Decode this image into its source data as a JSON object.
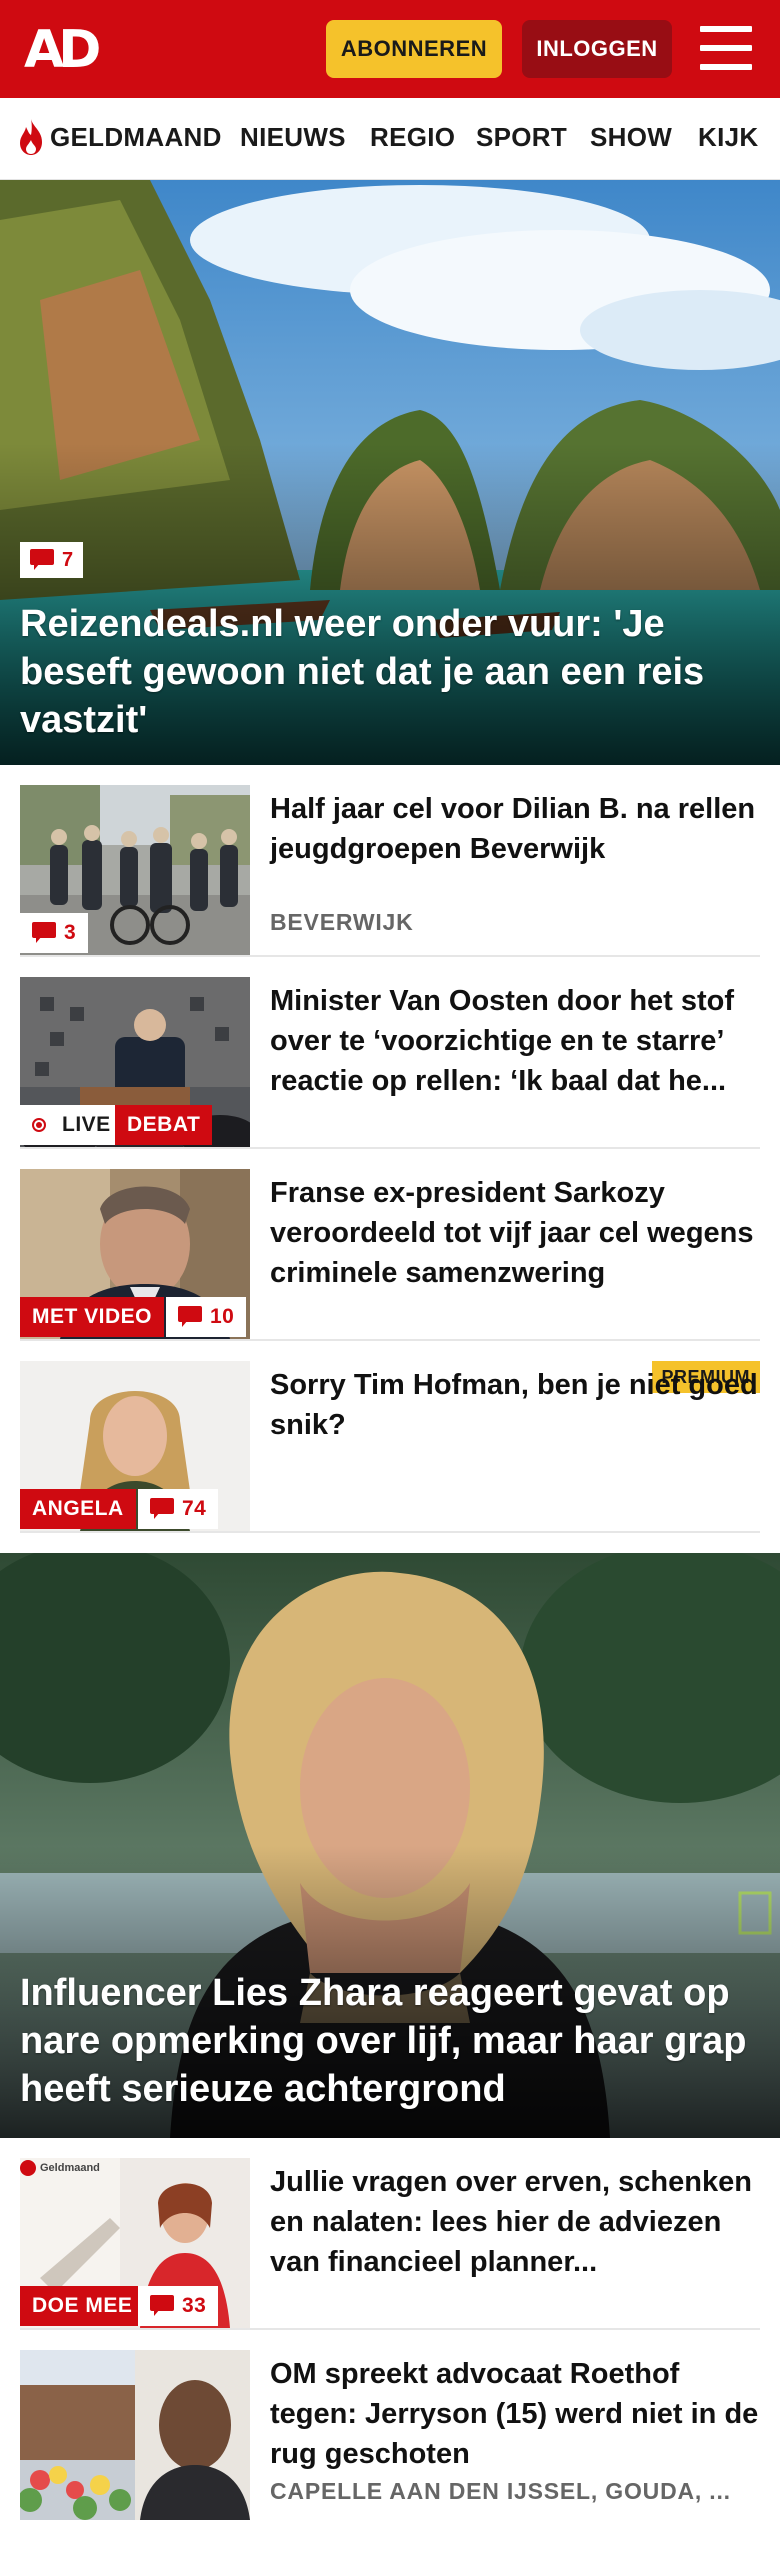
{
  "header": {
    "logo": "AD",
    "subscribe_label": "ABONNEREN",
    "login_label": "INLOGGEN"
  },
  "nav": {
    "items": [
      "GELDMAAND",
      "NIEUWS",
      "REGIO",
      "SPORT",
      "SHOW",
      "KIJK"
    ]
  },
  "articles": [
    {
      "title": "Reizendeals.nl weer onder vuur: 'Je beseft gewoon niet dat je aan een reis vastzit'",
      "comments": "7"
    },
    {
      "title": "Half jaar cel voor Dilian B. na rellen jeugdgroepen Beverwijk",
      "location": "BEVERWIJK",
      "comments": "3"
    },
    {
      "title": "Minister Van Oosten door het stof over te ‘voorzichtige en te starre’ reactie op rellen: ‘Ik baal dat he...",
      "live_label": "LIVE",
      "tag": "DEBAT"
    },
    {
      "title": "Franse ex-president Sarkozy veroordeeld tot vijf jaar cel wegens criminele samenzwering",
      "tag": "MET VIDEO",
      "comments": "10"
    },
    {
      "title": "Sorry Tim Hofman, ben je niet goed snik?",
      "tag": "ANGELA",
      "premium": "PREMIUM",
      "comments": "74"
    },
    {
      "title": "Influencer Lies Zhara reageert gevat op nare opmerking over lijf, maar haar grap heeft serieuze achtergrond"
    },
    {
      "title": "Jullie vragen over erven, schenken en nalaten: lees hier de adviezen van financieel planner...",
      "tag": "DOE MEE",
      "comments": "33",
      "thumb_caption": "Geldmaand"
    },
    {
      "title": "OM spreekt advocaat Roethof tegen: Jerryson (15) werd niet in de rug geschoten",
      "location": "CAPELLE AAN DEN IJSSEL, GOUDA, ..."
    }
  ],
  "colors": {
    "brand_red": "#cf0a11",
    "subscribe_yellow": "#f5c22b",
    "login_dark_red": "#980d14"
  }
}
